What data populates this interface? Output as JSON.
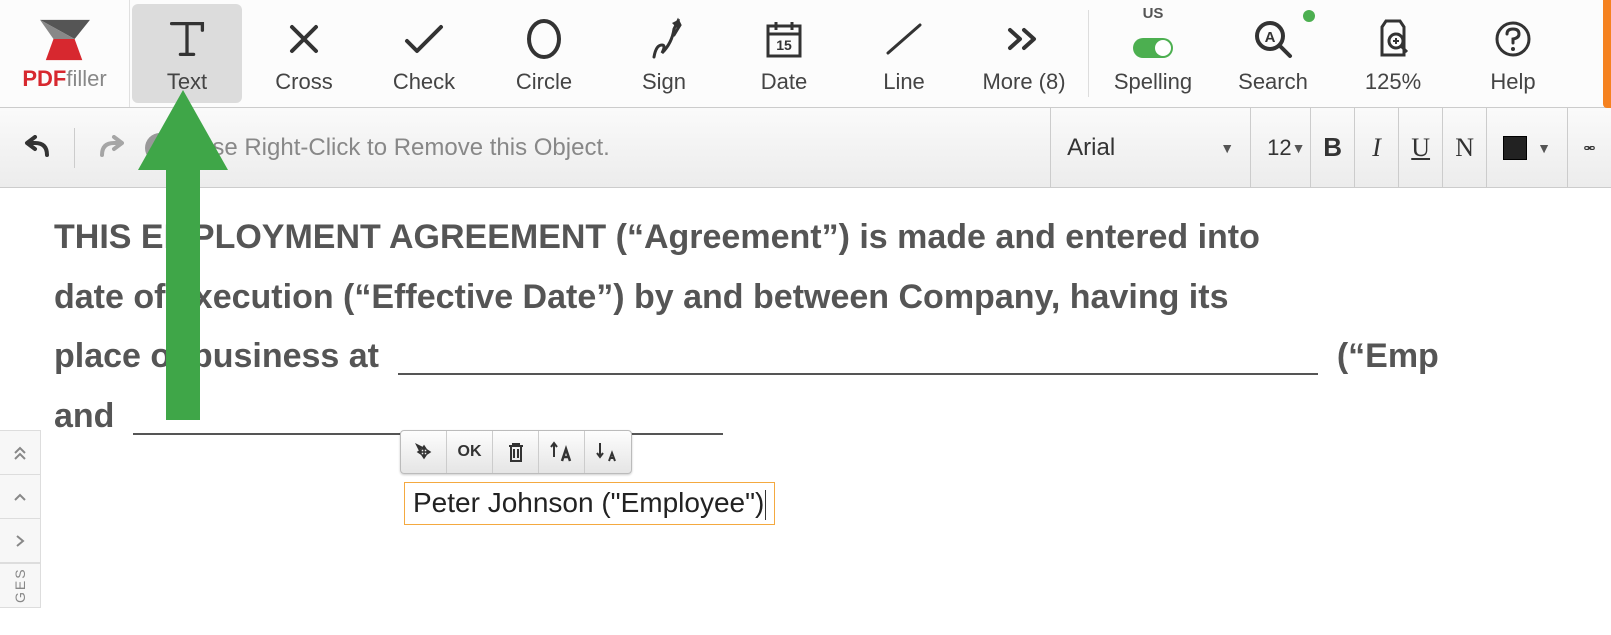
{
  "logo": {
    "brand_red": "PDF",
    "brand_gray": "filler"
  },
  "toolbar": {
    "text": "Text",
    "cross": "Cross",
    "check": "Check",
    "circle": "Circle",
    "sign": "Sign",
    "date": "Date",
    "line": "Line",
    "more": "More (8)",
    "spelling_region": "US",
    "spelling": "Spelling",
    "search": "Search",
    "zoom": "125%",
    "help": "Help"
  },
  "subbar": {
    "tip": "Use Right-Click to Remove this Object.",
    "font": "Arial",
    "size": "12",
    "bold": "B",
    "italic": "I",
    "underline": "U",
    "normal": "N"
  },
  "document": {
    "line1": "THIS EMPLOYMENT AGREEMENT (“Agreement”) is made and entered into",
    "line2a": "date of execution (“Effective Date”) by and between Company, having its",
    "line3a": "place of business at",
    "line3b": "(“Emp",
    "line4": "and"
  },
  "text_input": {
    "value": "Peter Johnson (\"Employee\")"
  },
  "float_toolbar": {
    "ok": "OK"
  },
  "sidebar": {
    "label": "GES"
  }
}
